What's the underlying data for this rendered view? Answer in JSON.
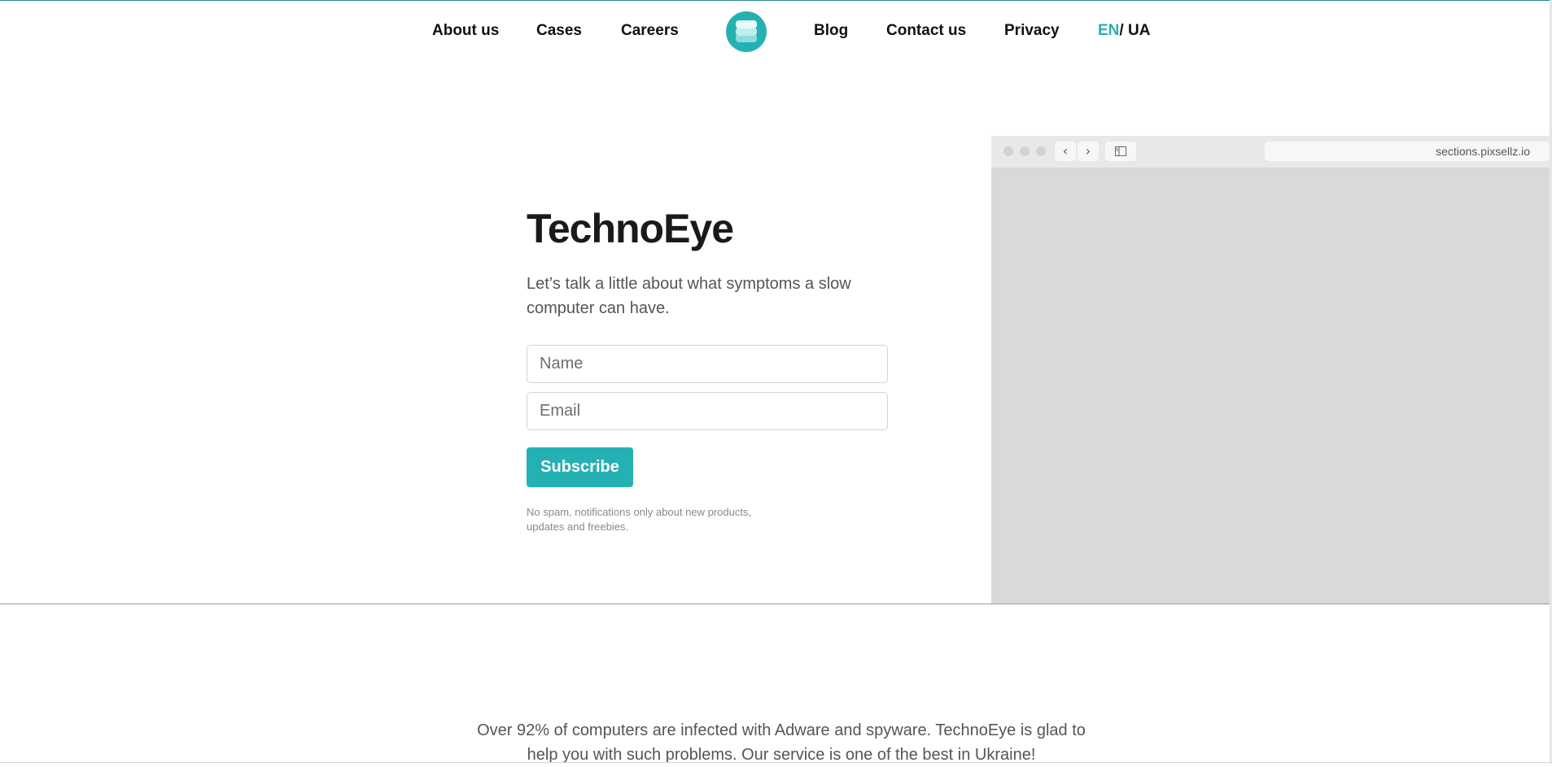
{
  "nav": {
    "about": "About us",
    "cases": "Cases",
    "careers": "Careers",
    "blog": "Blog",
    "contact": "Contact us",
    "privacy": "Privacy",
    "lang_en": "EN",
    "lang_sep": "/",
    "lang_ua": " UA",
    "logo_icon": "stacked-layers-icon"
  },
  "hero": {
    "title": "TechnoEye",
    "subtitle": "Let’s talk a little about what symptoms a slow computer can have.",
    "name_placeholder": "Name",
    "email_placeholder": "Email",
    "subscribe_label": "Subscribe",
    "fineprint": "No spam, notifications only about new products, updates and freebies."
  },
  "browser": {
    "url": "sections.pixsellz.io",
    "back_icon": "chevron-left-icon",
    "forward_icon": "chevron-right-icon",
    "sidebar_icon": "sidebar-toggle-icon"
  },
  "about": {
    "text": "Over 92% of computers are infected with Adware and spyware. TechnoEye is glad to help you with such problems. Our service is one of the best in Ukraine!"
  },
  "colors": {
    "accent": "#25b1b3",
    "text_dark": "#111111",
    "text_muted": "#555555",
    "browser_bg": "#d9d9d9"
  }
}
